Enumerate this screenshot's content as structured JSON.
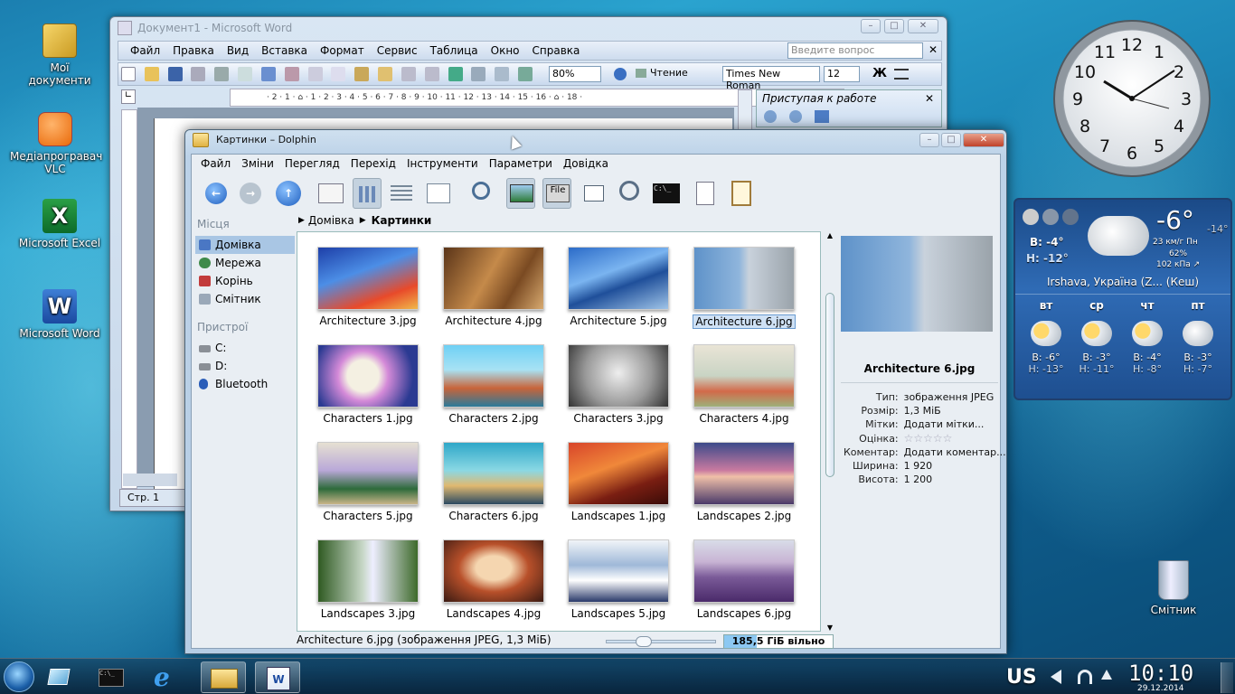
{
  "desktop": {
    "icons": [
      {
        "label": "Мої документи"
      },
      {
        "label": "Медіапрогравач VLC"
      },
      {
        "label": "Microsoft Excel"
      },
      {
        "label": "Microsoft Word"
      },
      {
        "label": "Смітник"
      }
    ]
  },
  "word": {
    "title": "Документ1 - Microsoft Word",
    "menu": [
      "Файл",
      "Правка",
      "Вид",
      "Вставка",
      "Формат",
      "Сервис",
      "Таблица",
      "Окно",
      "Справка"
    ],
    "help_placeholder": "Введите вопрос",
    "zoom": "80%",
    "reading_button": "Чтение",
    "font": "Times New Roman",
    "font_size": "12",
    "bold_button": "Ж",
    "taskpane_title": "Приступая к работе",
    "ruler": "· 2 · 1 · ⌂ · 1 · 2 · 3 · 4 · 5 · 6 · 7 · 8 · 9 · 10 · 11 · 12 · 13 · 14 · 15 · 16 · ⌂ · 18 ·",
    "status_page": "Стр. 1"
  },
  "dolphin": {
    "title": "Картинки – Dolphin",
    "menu": [
      "Файл",
      "Зміни",
      "Перегляд",
      "Перехід",
      "Інструменти",
      "Параметри",
      "Довідка"
    ],
    "places_header": "Місця",
    "places": [
      "Домівка",
      "Мережа",
      "Корінь",
      "Смітник"
    ],
    "devices_header": "Пристрої",
    "devices": [
      "C:",
      "D:",
      "Bluetooth"
    ],
    "breadcrumb": [
      "Домівка",
      "Картинки"
    ],
    "files": [
      "Architecture 3.jpg",
      "Architecture 4.jpg",
      "Architecture 5.jpg",
      "Architecture 6.jpg",
      "Characters 1.jpg",
      "Characters 2.jpg",
      "Characters 3.jpg",
      "Characters 4.jpg",
      "Characters 5.jpg",
      "Characters 6.jpg",
      "Landscapes 1.jpg",
      "Landscapes 2.jpg",
      "Landscapes 3.jpg",
      "Landscapes 4.jpg",
      "Landscapes 5.jpg",
      "Landscapes 6.jpg"
    ],
    "selected_file": "Architecture 6.jpg",
    "info": {
      "name": "Architecture 6.jpg",
      "rows": [
        {
          "k": "Тип:",
          "v": "зображення JPEG"
        },
        {
          "k": "Розмір:",
          "v": "1,3 МіБ"
        },
        {
          "k": "Мітки:",
          "v": "Додати мітки..."
        },
        {
          "k": "Оцінка:",
          "v": "☆☆☆☆☆"
        },
        {
          "k": "Коментар:",
          "v": "Додати коментар..."
        },
        {
          "k": "Ширина:",
          "v": "1 920"
        },
        {
          "k": "Висота:",
          "v": "1 200"
        }
      ]
    },
    "status": "Architecture 6.jpg (зображення JPEG, 1,3 МіБ)",
    "free_space": "185,5 ГіБ вільно",
    "free_fraction": 0.3
  },
  "clock": {
    "numerals": [
      "12",
      "1",
      "2",
      "3",
      "4",
      "5",
      "6",
      "7",
      "8",
      "9",
      "10",
      "11"
    ],
    "time": "10:10"
  },
  "weather": {
    "current_temp": "-6°",
    "feels": "-14°",
    "high": "В: -4°",
    "low": "Н: -12°",
    "wind": "23 км/г Пн",
    "humidity": "62%",
    "pressure": "102 кПа ↗",
    "location": "Irshava, Україна (Z... (Кеш)",
    "days": [
      {
        "day": "вт",
        "hi": "В: -6°",
        "lo": "Н: -13°"
      },
      {
        "day": "ср",
        "hi": "В: -3°",
        "lo": "Н: -11°"
      },
      {
        "day": "чт",
        "hi": "В: -4°",
        "lo": "Н: -8°"
      },
      {
        "day": "пт",
        "hi": "В: -3°",
        "lo": "Н: -7°"
      }
    ]
  },
  "taskbar": {
    "keyboard_layout": "US",
    "time": "10:10",
    "date": "29.12.2014"
  },
  "colors": {
    "accent": "#2a6db8",
    "selection": "#a9c6e4"
  }
}
